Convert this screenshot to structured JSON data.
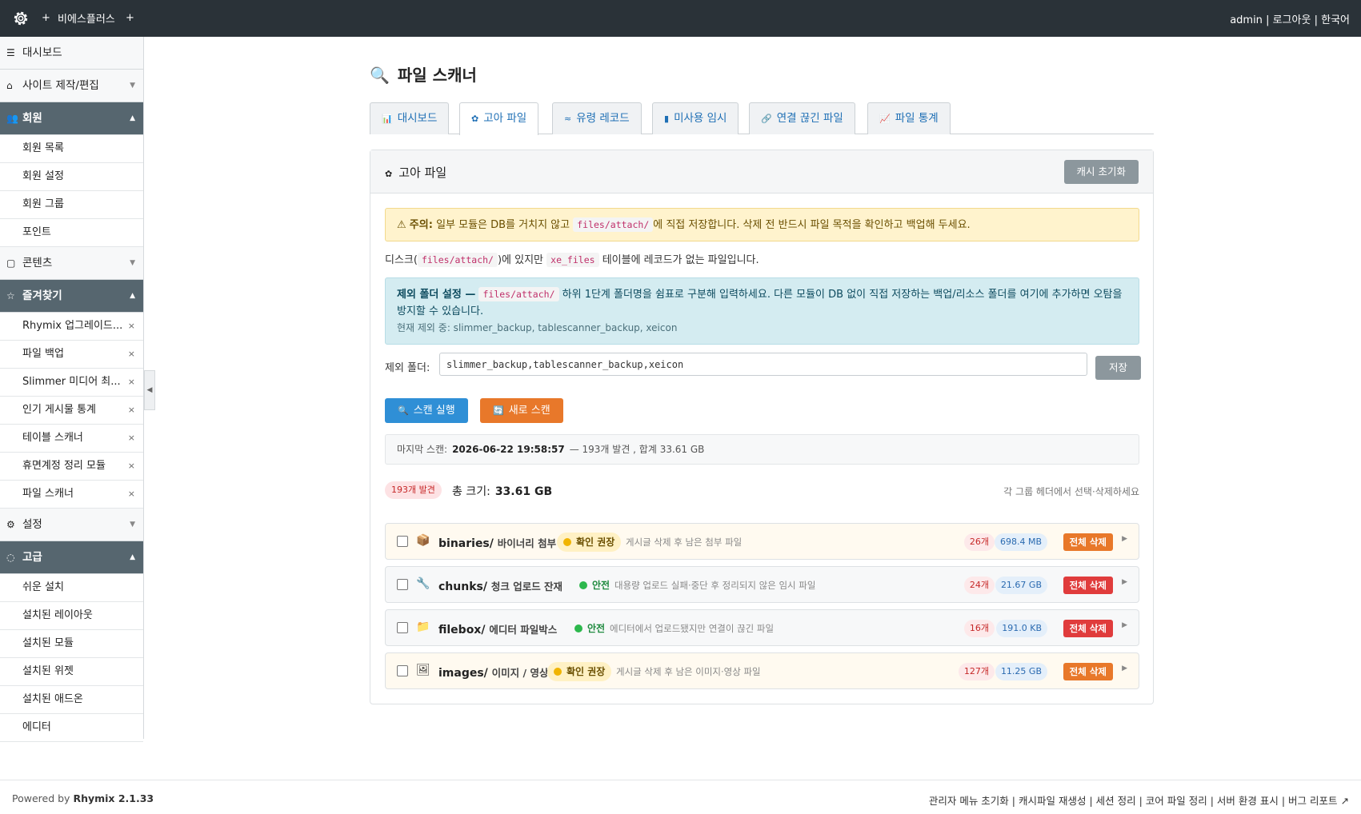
{
  "topbar": {
    "site_name": "비에스플러스",
    "plus": "+",
    "user": "admin",
    "logout": "로그아웃",
    "lang": "한국어",
    "sep": "|"
  },
  "sidebar": {
    "dashboard": "대시보드",
    "site_edit": "사이트 제작/편집",
    "member": "회원",
    "member_items": [
      "회원 목록",
      "회원 설정",
      "회원 그룹",
      "포인트"
    ],
    "contents": "콘텐츠",
    "favorites": "즐겨찾기",
    "favorite_items": [
      "Rhymix 업그레이드...",
      "파일 백업",
      "Slimmer 미디어 최...",
      "인기 게시물 통계",
      "테이블 스캐너",
      "휴면계정 정리 모듈",
      "파일 스캐너"
    ],
    "settings": "설정",
    "advanced": "고급",
    "advanced_items": [
      "쉬운 설치",
      "설치된 레이아웃",
      "설치된 모듈",
      "설치된 위젯",
      "설치된 애드온",
      "에디터"
    ]
  },
  "page": {
    "title": "파일 스캐너",
    "tabs": [
      "대시보드",
      "고아 파일",
      "유령 레코드",
      "미사용 임시",
      "연결 끊긴 파일",
      "파일 통계"
    ],
    "active_tab": "고아 파일"
  },
  "panel": {
    "title": "고아 파일",
    "cache_button": "캐시 초기화",
    "warn_label": "주의:",
    "warn_text1": "일부 모듈은 DB를 거치지 않고",
    "warn_code": "files/attach/",
    "warn_text2": "에 직접 저장합니다. 삭제 전 반드시 파일 목적을 확인하고 백업해 두세요.",
    "desc_text1": "디스크(",
    "desc_code1": "files/attach/",
    "desc_text2": ")에 있지만",
    "desc_code2": "xe_files",
    "desc_text3": "테이블에 레코드가 없는 파일입니다.",
    "info_label": "제외 폴더 설정 —",
    "info_code": "files/attach/",
    "info_text": "하위 1단계 폴더명을 쉼표로 구분해 입력하세요. 다른 모듈이 DB 없이 직접 저장하는 백업/리소스 폴더를 여기에 추가하면 오탐을 방지할 수 있습니다.",
    "info_sub": "현재 제외 중: slimmer_backup, tablescanner_backup, xeicon",
    "exclude_label": "제외 폴더:",
    "exclude_value": "slimmer_backup,tablescanner_backup,xeicon",
    "save_button": "저장",
    "scan_button": "스캔 실행",
    "rescan_button": "새로 스캔",
    "last_scan_label": "마지막 스캔:",
    "last_scan_time": "2026-06-22 19:58:57",
    "last_scan_text": "— 193개 발견 , 합계 33.61 GB",
    "found_badge": "193개 발견",
    "total_label": "총 크기:",
    "total_value": "33.61 GB",
    "hint": "각 그룹 헤더에서 선택·삭제하세요"
  },
  "groups": [
    {
      "icon": "📦",
      "name": "binaries/",
      "desc": "바이너리 첨부",
      "status": "확인 권장",
      "note": "게시글 삭제 후 남은 첨부 파일",
      "count": "26개",
      "size": "698.4 MB",
      "delete": "전체 삭제"
    },
    {
      "icon": "🔧",
      "name": "chunks/",
      "desc": "청크 업로드 잔재",
      "status": "안전",
      "note": "대용량 업로드 실패·중단 후 정리되지 않은 임시 파일",
      "count": "24개",
      "size": "21.67 GB",
      "delete": "전체 삭제"
    },
    {
      "icon": "📁",
      "name": "filebox/",
      "desc": "에디터 파일박스",
      "status": "안전",
      "note": "에디터에서 업로드됐지만 연결이 끊긴 파일",
      "count": "16개",
      "size": "191.0 KB",
      "delete": "전체 삭제"
    },
    {
      "icon": "🖼",
      "name": "images/",
      "desc": "이미지 / 영상",
      "status": "확인 권장",
      "note": "게시글 삭제 후 남은 이미지·영상 파일",
      "count": "127개",
      "size": "11.25 GB",
      "delete": "전체 삭제"
    }
  ],
  "footer": {
    "powered_by": "Powered by",
    "product": "Rhymix 2.1.33",
    "links": [
      "관리자 메뉴 초기화",
      "캐시파일 재생성",
      "세션 정리",
      "코어 파일 정리",
      "서버 환경 표시",
      "버그 리포트"
    ]
  }
}
